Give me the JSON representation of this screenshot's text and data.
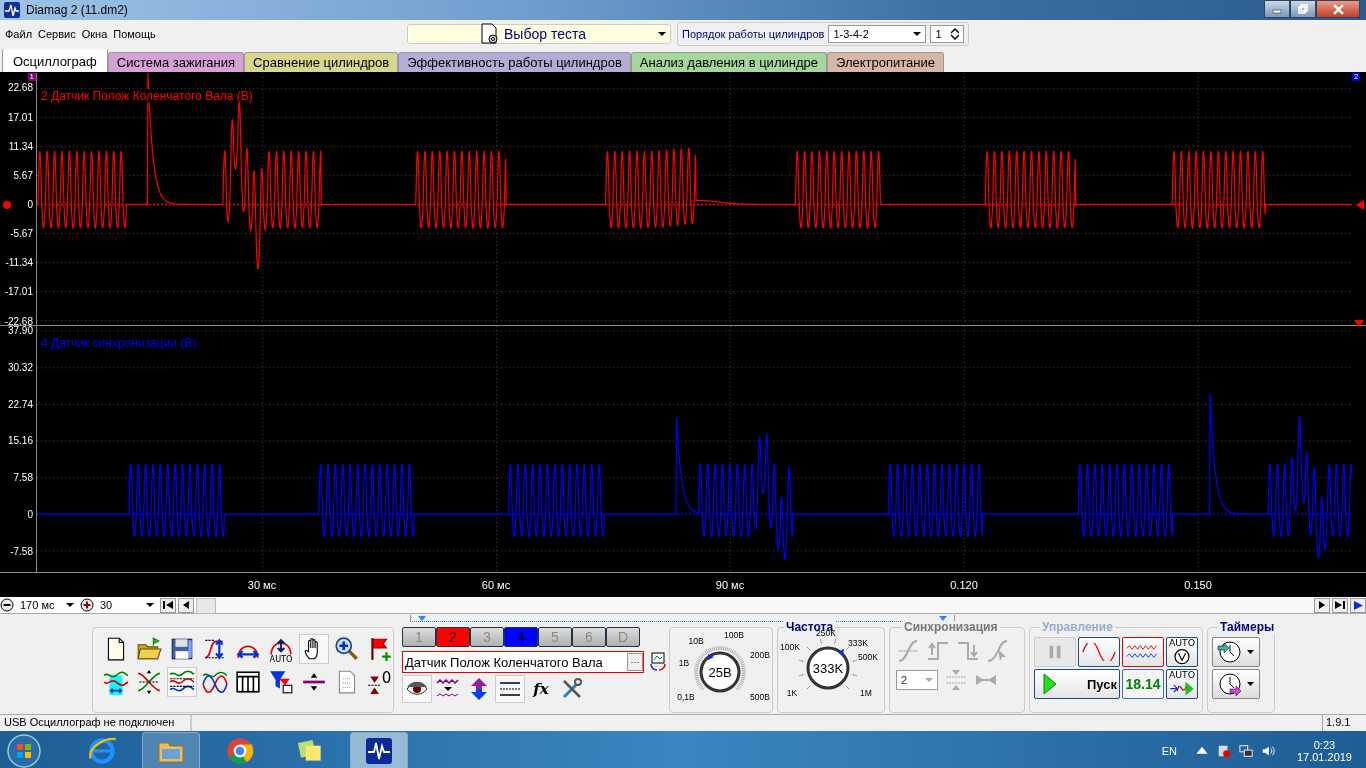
{
  "window": {
    "title": "Diamag 2 (11.dm2)"
  },
  "menu": [
    "Файл",
    "Сервис",
    "Окна",
    "Помощь"
  ],
  "test_selector": {
    "value": "Выбор теста"
  },
  "cylinder_order": {
    "label": "Порядок работы цилиндров",
    "value": "1-3-4-2",
    "spin_value": "1"
  },
  "tabs": [
    {
      "label": "Осциллограф",
      "selected": true,
      "color": "#f4f4f4"
    },
    {
      "label": "Система зажигания",
      "selected": false,
      "color": "#d6a2d6"
    },
    {
      "label": "Сравнение цилиндров",
      "selected": false,
      "color": "#d6d68e"
    },
    {
      "label": "Эффективность работы цилиндров",
      "selected": false,
      "color": "#b4acd4"
    },
    {
      "label": "Анализ давления в цилиндре",
      "selected": false,
      "color": "#a6d69c"
    },
    {
      "label": "Электропитание",
      "selected": false,
      "color": "#d8b6a6"
    }
  ],
  "scope": {
    "cursor_labels": [
      "1",
      "2"
    ],
    "channels": [
      {
        "title": "2 Датчик Полож Коленчатого Вала (В)",
        "color": "#ff0000",
        "y_ticks": [
          "22.68",
          "17.01",
          "11.34",
          "5.67",
          "0",
          "-5.67",
          "-11.34",
          "-17.01",
          "-22.68"
        ]
      },
      {
        "title": "4 Датчик синхронизации (В)",
        "color": "#0000ff",
        "y_ticks": [
          "37.90",
          "30.32",
          "22.74",
          "15.16",
          "7.58",
          "0",
          "-7.58"
        ]
      }
    ],
    "x_ticks": [
      "30 мс",
      "60 мс",
      "90 мс",
      "0.120",
      "0.150"
    ]
  },
  "timebase": {
    "value": "170 мс"
  },
  "scale": {
    "value": "30"
  },
  "toolbar": {
    "buttons": [
      {
        "pressed": false
      },
      {
        "pressed": false
      },
      {
        "pressed": false
      },
      {
        "pressed": false
      },
      {
        "pressed": false
      },
      {
        "pressed": false,
        "caption": "AUTO"
      },
      {
        "pressed": true
      },
      {
        "pressed": false
      },
      {
        "pressed": false
      },
      {
        "pressed": false
      },
      {
        "pressed": false
      },
      {
        "pressed": true
      },
      {
        "pressed": false
      },
      {
        "pressed": false
      },
      {
        "pressed": false
      },
      {
        "pressed": false
      },
      {
        "pressed": false
      },
      {
        "pressed": false,
        "caption": "0"
      }
    ]
  },
  "channel_buttons": [
    {
      "label": "1",
      "on": false
    },
    {
      "label": "2",
      "on": true,
      "color": "#ff0000"
    },
    {
      "label": "3",
      "on": false
    },
    {
      "label": "4",
      "on": true,
      "color": "#0000ff"
    },
    {
      "label": "5",
      "on": false
    },
    {
      "label": "6",
      "on": false
    },
    {
      "label": "D",
      "on": false
    }
  ],
  "channel_name": {
    "value": "Датчик Полож Коленчатого Вала",
    "browse": "···"
  },
  "channel_tools": [
    {
      "pressed": true
    },
    {
      "pressed": false
    },
    {
      "pressed": false
    },
    {
      "pressed": true
    },
    {
      "pressed": false,
      "caption": "fx"
    },
    {
      "pressed": false
    }
  ],
  "voltage_knob": {
    "value": "25В",
    "labels": [
      "0,1В",
      "1В",
      "10В",
      "100В",
      "200В",
      "500В"
    ]
  },
  "frequency": {
    "title": "Частота",
    "value": "333K",
    "labels": [
      "1K",
      "100K",
      "250K",
      "333K",
      "500K",
      "1M"
    ]
  },
  "sync": {
    "title": "Синхронизация",
    "disabled": true,
    "channel": "2"
  },
  "control": {
    "title": "Управление",
    "start": "Пуск",
    "reading": "18.14",
    "auto_captions": [
      "AUTO",
      "AUTO"
    ]
  },
  "timers": {
    "title": "Таймеры"
  },
  "status_bar": {
    "message": "USB Осциллограф не подключен",
    "version": "1.9.1"
  },
  "taskbar": {
    "language": "EN",
    "time": "0:23",
    "date": "17.01.2019"
  }
}
